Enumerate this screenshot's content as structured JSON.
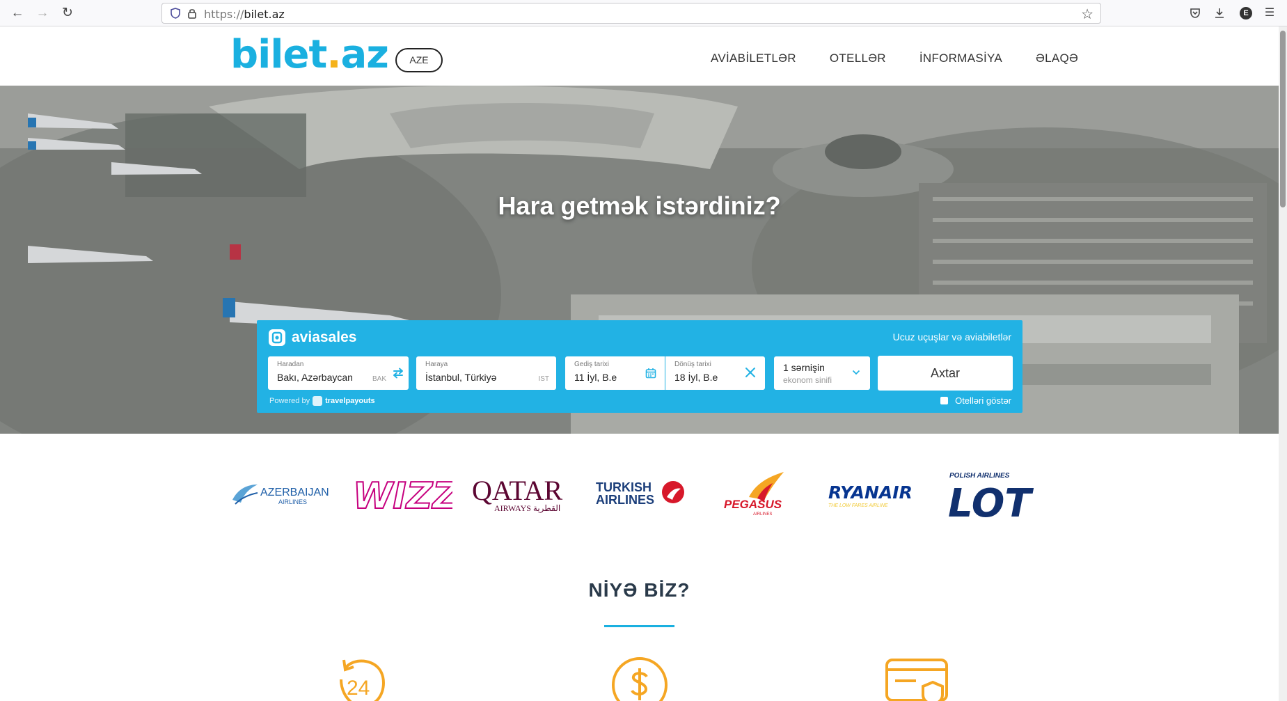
{
  "browser": {
    "url_scheme": "https://",
    "url_host": "bilet.az",
    "account_initial": "E"
  },
  "header": {
    "logo_main": "bilet",
    "logo_dot": ".",
    "logo_tld": "az",
    "language": "AZE",
    "nav": [
      "AVİABİLETLƏR",
      "OTELLƏR",
      "İNFORMASİYA",
      "ƏLAQƏ"
    ]
  },
  "hero": {
    "title": "Hara getmək istərdiniz?"
  },
  "widget": {
    "brand": "aviasales",
    "tagline": "Ucuz uçuşlar və aviabiletlər",
    "origin_label": "Haradan",
    "origin_value": "Bakı, Azərbaycan",
    "origin_code": "BAK",
    "dest_label": "Haraya",
    "dest_value": "İstanbul, Türkiyə",
    "dest_code": "IST",
    "depart_label": "Gediş tarixi",
    "depart_value": "11 İyl, B.e",
    "return_label": "Dönüş tarixi",
    "return_value": "18 İyl, B.e",
    "passengers": "1 sərnişin",
    "cabin_class": "ekonom sinifi",
    "search_label": "Axtar",
    "powered_by": "Powered by",
    "powered_brand": "travelpayouts",
    "hotels_label": "Otelləri göstər"
  },
  "airlines": [
    {
      "name": "Azerbaijan Airlines",
      "text_main": "AZERBAIJAN",
      "text_sub": "AIRLINES"
    },
    {
      "name": "Wizz Air",
      "text_main": "WIZZ"
    },
    {
      "name": "Qatar Airways",
      "text_main": "QATAR",
      "text_sub": "AIRWAYS القطرية"
    },
    {
      "name": "Turkish Airlines",
      "text_main": "TURKISH",
      "text_sub": "AIRLINES"
    },
    {
      "name": "Pegasus",
      "text_main": "PEGASUS",
      "text_sub": "AIRLINES"
    },
    {
      "name": "Ryanair",
      "text_main": "RYANAIR",
      "text_sub": "THE LOW FARES AIRLINE"
    },
    {
      "name": "LOT",
      "text_main": "LOT",
      "text_sub": "POLISH AIRLINES"
    }
  ],
  "why": {
    "title": "NİYƏ BİZ?",
    "feature_1_text": "24"
  },
  "colors": {
    "brand_blue": "#1ab0e0",
    "brand_yellow": "#f5b21a",
    "widget_blue": "#22b2e4",
    "icon_orange": "#f5a623"
  }
}
